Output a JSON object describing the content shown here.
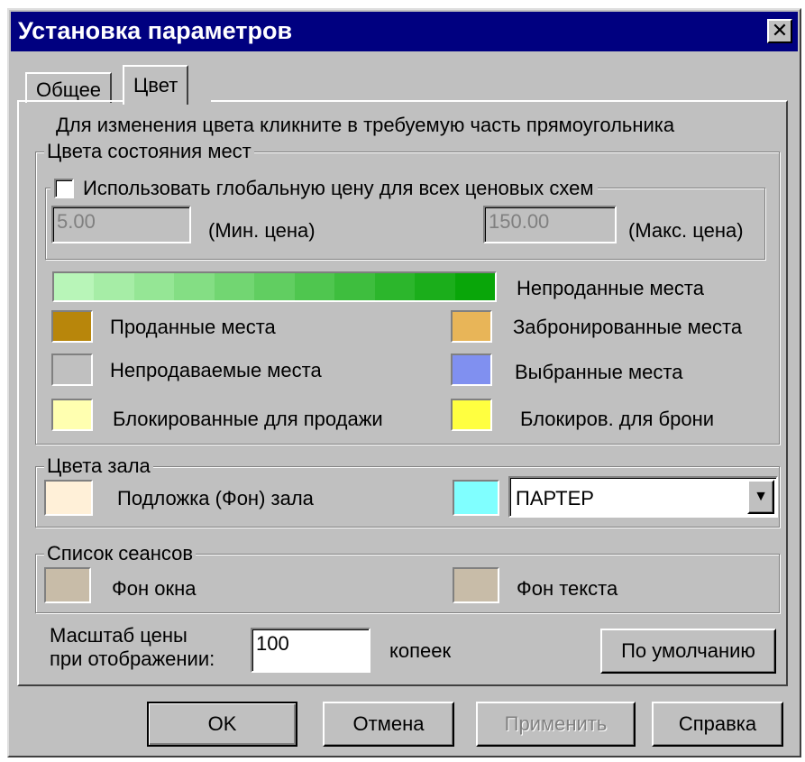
{
  "window": {
    "title": "Установка параметров"
  },
  "tabs": [
    {
      "label": "Общее"
    },
    {
      "label": "Цвет"
    }
  ],
  "instruction": "Для изменения цвета кликните в требуемую часть прямоугольника",
  "seat_colors": {
    "legend": "Цвета состояния мест",
    "global_price_checkbox": {
      "label": "Использовать глобальную цену для всех ценовых схем",
      "checked": false
    },
    "min_price": {
      "value": "5.00",
      "label": "(Мин. цена)"
    },
    "max_price": {
      "value": "150.00",
      "label": "(Макс. цена)"
    },
    "gradient_colors": [
      "#b8f5b8",
      "#a6eda6",
      "#95e695",
      "#84de84",
      "#72d672",
      "#61ce61",
      "#4fc64f",
      "#3ebe3e",
      "#2cb62c",
      "#1bae1b",
      "#09a609"
    ],
    "unsold_label": "Непроданные места",
    "items": [
      {
        "label": "Проданные места",
        "color": "#b8860b"
      },
      {
        "label": "Забронированные места",
        "color": "#e8b558"
      },
      {
        "label": "Непродаваемые места",
        "color": "#c0c0c0"
      },
      {
        "label": "Выбранные места",
        "color": "#8090f0"
      },
      {
        "label": "Блокированные для продажи",
        "color": "#ffffb0"
      },
      {
        "label": "Блокиров. для брони",
        "color": "#ffff40"
      }
    ]
  },
  "hall_colors": {
    "legend": "Цвета зала",
    "background_label": "Подложка (Фон) зала",
    "background_color": "#fff0d8",
    "zone_color": "#80ffff",
    "zone_select": "ПАРТЕР"
  },
  "session_list": {
    "legend": "Список сеансов",
    "window_bg_label": "Фон окна",
    "window_bg_color": "#c8bca8",
    "text_bg_label": "Фон текста",
    "text_bg_color": "#c8bca8"
  },
  "scale": {
    "label_line1": "Масштаб цены",
    "label_line2": "при отображении:",
    "value": "100",
    "unit": "копеек",
    "default_button": "По умолчанию"
  },
  "buttons": {
    "ok": "OK",
    "cancel": "Отмена",
    "apply": "Применить",
    "help": "Справка"
  }
}
